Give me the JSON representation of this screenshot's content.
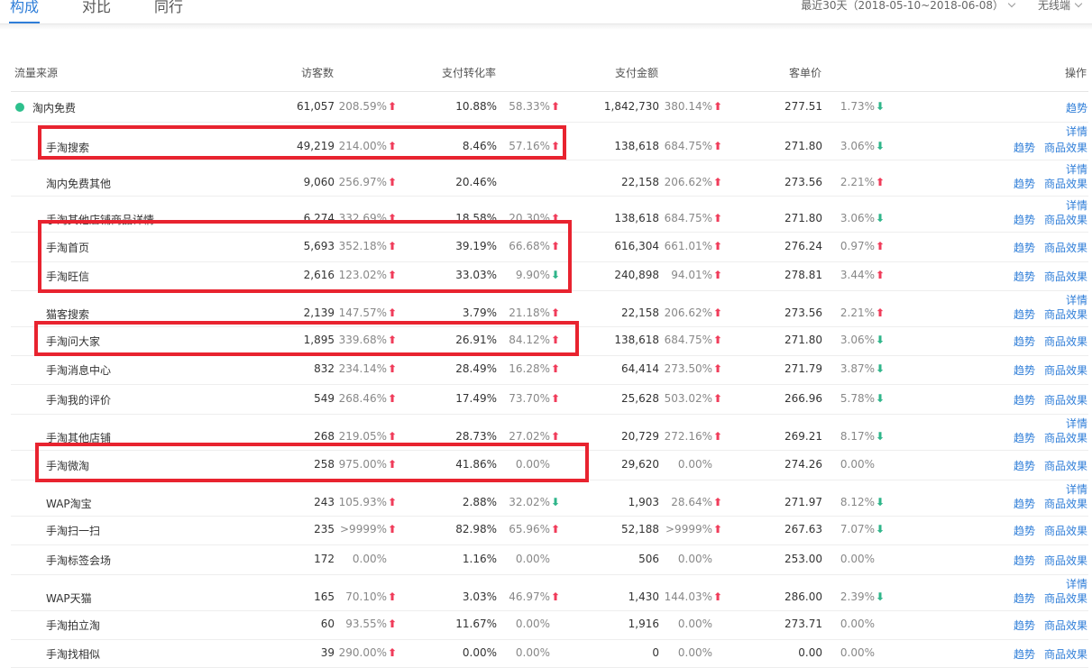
{
  "tabs": [
    {
      "label": "构成",
      "active": true
    },
    {
      "label": "对比",
      "active": false
    },
    {
      "label": "同行",
      "active": false
    }
  ],
  "date_range": "最近30天（2018-05-10~2018-06-08）",
  "device": "无线端",
  "columns": {
    "source": "流量来源",
    "visitors": "访客数",
    "conversion": "支付转化率",
    "payment": "支付金额",
    "unit_price": "客单价",
    "ops": "操作"
  },
  "colors": {
    "accent": "#2f7ed8",
    "up": "#f03c5a",
    "down": "#2fb58a",
    "highlight": "#e8232f",
    "dot": "#2ec08d"
  },
  "rows": [
    {
      "name": "淘内免费",
      "level": 1,
      "visitors": "61,057",
      "visitors_chg": "208.59%",
      "visitors_dir": "up",
      "conversion": "10.88%",
      "conversion_chg": "58.33%",
      "conversion_dir": "up",
      "payment": "1,842,730",
      "payment_chg": "380.14%",
      "payment_dir": "up",
      "unit_price": "277.51",
      "unit_price_chg": "1.73%",
      "unit_price_dir": "down",
      "actions": [
        "趋势"
      ]
    },
    {
      "name": "手淘搜索",
      "visitors": "49,219",
      "visitors_chg": "214.00%",
      "visitors_dir": "up",
      "conversion": "8.46%",
      "conversion_chg": "57.16%",
      "conversion_dir": "up",
      "payment": "138,618",
      "payment_chg": "684.75%",
      "payment_dir": "up",
      "unit_price": "271.80",
      "unit_price_chg": "3.06%",
      "unit_price_dir": "down",
      "detail": "详情",
      "actions": [
        "趋势",
        "商品效果"
      ]
    },
    {
      "name": "淘内免费其他",
      "visitors": "9,060",
      "visitors_chg": "256.97%",
      "visitors_dir": "up",
      "conversion": "20.46%",
      "conversion_chg": "",
      "conversion_dir": "",
      "payment": "22,158",
      "payment_chg": "206.62%",
      "payment_dir": "up",
      "unit_price": "273.56",
      "unit_price_chg": "2.21%",
      "unit_price_dir": "up",
      "detail": "详情",
      "actions": [
        "趋势",
        "商品效果"
      ]
    },
    {
      "name": "手淘其他店铺商品详情",
      "visitors": "6,274",
      "visitors_chg": "332.69%",
      "visitors_dir": "up",
      "conversion": "18.58%",
      "conversion_chg": "20.30%",
      "conversion_dir": "up",
      "payment": "138,618",
      "payment_chg": "684.75%",
      "payment_dir": "up",
      "unit_price": "271.80",
      "unit_price_chg": "3.06%",
      "unit_price_dir": "down",
      "detail": "详情",
      "actions": [
        "趋势",
        "商品效果"
      ]
    },
    {
      "name": "手淘首页",
      "visitors": "5,693",
      "visitors_chg": "352.18%",
      "visitors_dir": "up",
      "conversion": "39.19%",
      "conversion_chg": "66.68%",
      "conversion_dir": "up",
      "payment": "616,304",
      "payment_chg": "661.01%",
      "payment_dir": "up",
      "unit_price": "276.24",
      "unit_price_chg": "0.97%",
      "unit_price_dir": "up",
      "actions": [
        "趋势",
        "商品效果"
      ]
    },
    {
      "name": "手淘旺信",
      "visitors": "2,616",
      "visitors_chg": "123.02%",
      "visitors_dir": "up",
      "conversion": "33.03%",
      "conversion_chg": "9.90%",
      "conversion_dir": "down",
      "payment": "240,898",
      "payment_chg": "94.01%",
      "payment_dir": "up",
      "unit_price": "278.81",
      "unit_price_chg": "3.44%",
      "unit_price_dir": "up",
      "actions": [
        "趋势",
        "商品效果"
      ]
    },
    {
      "name": "猫客搜索",
      "visitors": "2,139",
      "visitors_chg": "147.57%",
      "visitors_dir": "up",
      "conversion": "3.79%",
      "conversion_chg": "21.18%",
      "conversion_dir": "up",
      "payment": "22,158",
      "payment_chg": "206.62%",
      "payment_dir": "up",
      "unit_price": "273.56",
      "unit_price_chg": "2.21%",
      "unit_price_dir": "up",
      "detail": "详情",
      "actions": [
        "趋势",
        "商品效果"
      ]
    },
    {
      "name": "手淘问大家",
      "visitors": "1,895",
      "visitors_chg": "339.68%",
      "visitors_dir": "up",
      "conversion": "26.91%",
      "conversion_chg": "84.12%",
      "conversion_dir": "up",
      "payment": "138,618",
      "payment_chg": "684.75%",
      "payment_dir": "up",
      "unit_price": "271.80",
      "unit_price_chg": "3.06%",
      "unit_price_dir": "down",
      "actions": [
        "趋势",
        "商品效果"
      ]
    },
    {
      "name": "手淘消息中心",
      "visitors": "832",
      "visitors_chg": "234.14%",
      "visitors_dir": "up",
      "conversion": "28.49%",
      "conversion_chg": "16.28%",
      "conversion_dir": "up",
      "payment": "64,414",
      "payment_chg": "273.50%",
      "payment_dir": "up",
      "unit_price": "271.79",
      "unit_price_chg": "3.87%",
      "unit_price_dir": "down",
      "actions": [
        "趋势",
        "商品效果"
      ]
    },
    {
      "name": "手淘我的评价",
      "visitors": "549",
      "visitors_chg": "268.46%",
      "visitors_dir": "up",
      "conversion": "17.49%",
      "conversion_chg": "73.70%",
      "conversion_dir": "up",
      "payment": "25,628",
      "payment_chg": "503.02%",
      "payment_dir": "up",
      "unit_price": "266.96",
      "unit_price_chg": "5.78%",
      "unit_price_dir": "down",
      "actions": [
        "趋势",
        "商品效果"
      ]
    },
    {
      "name": "手淘其他店铺",
      "visitors": "268",
      "visitors_chg": "219.05%",
      "visitors_dir": "up",
      "conversion": "28.73%",
      "conversion_chg": "27.02%",
      "conversion_dir": "up",
      "payment": "20,729",
      "payment_chg": "272.16%",
      "payment_dir": "up",
      "unit_price": "269.21",
      "unit_price_chg": "8.17%",
      "unit_price_dir": "down",
      "detail": "详情",
      "actions": [
        "趋势",
        "商品效果"
      ]
    },
    {
      "name": "手淘微淘",
      "visitors": "258",
      "visitors_chg": "975.00%",
      "visitors_dir": "up",
      "conversion": "41.86%",
      "conversion_chg": "0.00%",
      "conversion_dir": "",
      "payment": "29,620",
      "payment_chg": "0.00%",
      "payment_dir": "",
      "unit_price": "274.26",
      "unit_price_chg": "0.00%",
      "unit_price_dir": "",
      "actions": [
        "趋势",
        "商品效果"
      ]
    },
    {
      "name": "WAP淘宝",
      "visitors": "243",
      "visitors_chg": "105.93%",
      "visitors_dir": "up",
      "conversion": "2.88%",
      "conversion_chg": "32.02%",
      "conversion_dir": "down",
      "payment": "1,903",
      "payment_chg": "28.64%",
      "payment_dir": "up",
      "unit_price": "271.97",
      "unit_price_chg": "8.12%",
      "unit_price_dir": "down",
      "detail": "详情",
      "actions": [
        "趋势",
        "商品效果"
      ]
    },
    {
      "name": "手淘扫一扫",
      "visitors": "235",
      "visitors_chg": ">9999%",
      "visitors_dir": "up",
      "conversion": "82.98%",
      "conversion_chg": "65.96%",
      "conversion_dir": "up",
      "payment": "52,188",
      "payment_chg": ">9999%",
      "payment_dir": "up",
      "unit_price": "267.63",
      "unit_price_chg": "7.07%",
      "unit_price_dir": "down",
      "actions": [
        "趋势",
        "商品效果"
      ]
    },
    {
      "name": "手淘标签会场",
      "visitors": "172",
      "visitors_chg": "0.00%",
      "visitors_dir": "",
      "conversion": "1.16%",
      "conversion_chg": "0.00%",
      "conversion_dir": "",
      "payment": "506",
      "payment_chg": "0.00%",
      "payment_dir": "",
      "unit_price": "253.00",
      "unit_price_chg": "0.00%",
      "unit_price_dir": "",
      "actions": [
        "趋势",
        "商品效果"
      ]
    },
    {
      "name": "WAP天猫",
      "visitors": "165",
      "visitors_chg": "70.10%",
      "visitors_dir": "up",
      "conversion": "3.03%",
      "conversion_chg": "46.97%",
      "conversion_dir": "up",
      "payment": "1,430",
      "payment_chg": "144.03%",
      "payment_dir": "up",
      "unit_price": "286.00",
      "unit_price_chg": "2.39%",
      "unit_price_dir": "down",
      "detail": "详情",
      "actions": [
        "趋势",
        "商品效果"
      ]
    },
    {
      "name": "手淘拍立淘",
      "visitors": "60",
      "visitors_chg": "93.55%",
      "visitors_dir": "up",
      "conversion": "11.67%",
      "conversion_chg": "0.00%",
      "conversion_dir": "",
      "payment": "1,916",
      "payment_chg": "0.00%",
      "payment_dir": "",
      "unit_price": "273.71",
      "unit_price_chg": "0.00%",
      "unit_price_dir": "",
      "actions": [
        "趋势",
        "商品效果"
      ]
    },
    {
      "name": "手淘找相似",
      "visitors": "39",
      "visitors_chg": "290.00%",
      "visitors_dir": "up",
      "conversion": "0.00%",
      "conversion_chg": "0.00%",
      "conversion_dir": "",
      "payment": "0",
      "payment_chg": "0.00%",
      "payment_dir": "",
      "unit_price": "0.00",
      "unit_price_chg": "0.00%",
      "unit_price_dir": "",
      "actions": [
        "趋势",
        "商品效果"
      ]
    }
  ]
}
